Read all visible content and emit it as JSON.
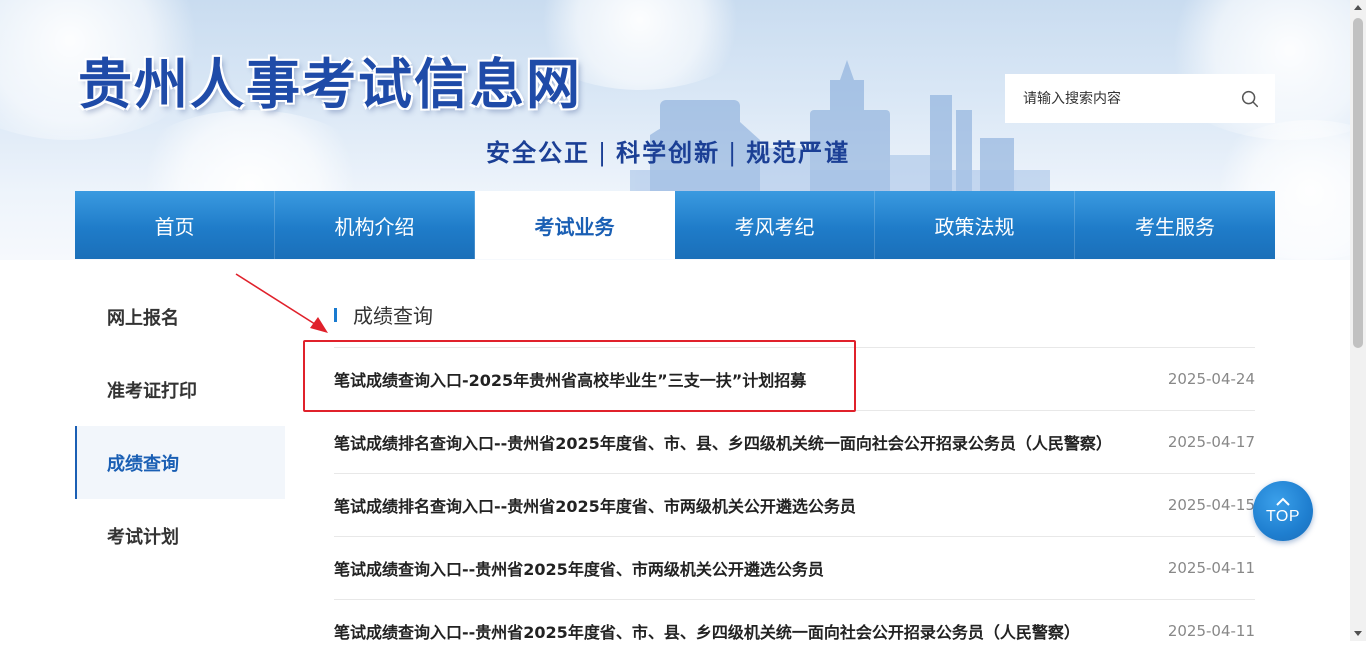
{
  "header": {
    "site_title": "贵州人事考试信息网",
    "slogan": [
      "安全公正",
      "科学创新",
      "规范严谨"
    ],
    "slogan_separator": "|",
    "search": {
      "placeholder": "请输入搜索内容",
      "icon": "search-icon"
    }
  },
  "nav": {
    "items": [
      {
        "label": "首页",
        "active": false
      },
      {
        "label": "机构介绍",
        "active": false
      },
      {
        "label": "考试业务",
        "active": true
      },
      {
        "label": "考风考纪",
        "active": false
      },
      {
        "label": "政策法规",
        "active": false
      },
      {
        "label": "考生服务",
        "active": false
      }
    ]
  },
  "sidebar": {
    "items": [
      {
        "label": "网上报名",
        "active": false
      },
      {
        "label": "准考证打印",
        "active": false
      },
      {
        "label": "成绩查询",
        "active": true
      },
      {
        "label": "考试计划",
        "active": false
      }
    ]
  },
  "main": {
    "section_title": "成绩查询",
    "list": [
      {
        "title": "笔试成绩查询入口-2025年贵州省高校毕业生”三支一扶”计划招募",
        "date": "2025-04-24",
        "highlighted": true
      },
      {
        "title": "笔试成绩排名查询入口--贵州省2025年度省、市、县、乡四级机关统一面向社会公开招录公务员（人民警察）",
        "date": "2025-04-17",
        "highlighted": false
      },
      {
        "title": "笔试成绩排名查询入口--贵州省2025年度省、市两级机关公开遴选公务员",
        "date": "2025-04-15",
        "highlighted": false
      },
      {
        "title": "笔试成绩查询入口--贵州省2025年度省、市两级机关公开遴选公务员",
        "date": "2025-04-11",
        "highlighted": false
      },
      {
        "title": "笔试成绩查询入口--贵州省2025年度省、市、县、乡四级机关统一面向社会公开招录公务员（人民警察）",
        "date": "2025-04-11",
        "highlighted": false
      }
    ]
  },
  "back_to_top": {
    "label": "TOP",
    "icon": "chevron-up-icon"
  },
  "colors": {
    "primary_blue": "#1a5fb4",
    "nav_blue": "#1f7cc9",
    "annotation_red": "#e0212b"
  }
}
